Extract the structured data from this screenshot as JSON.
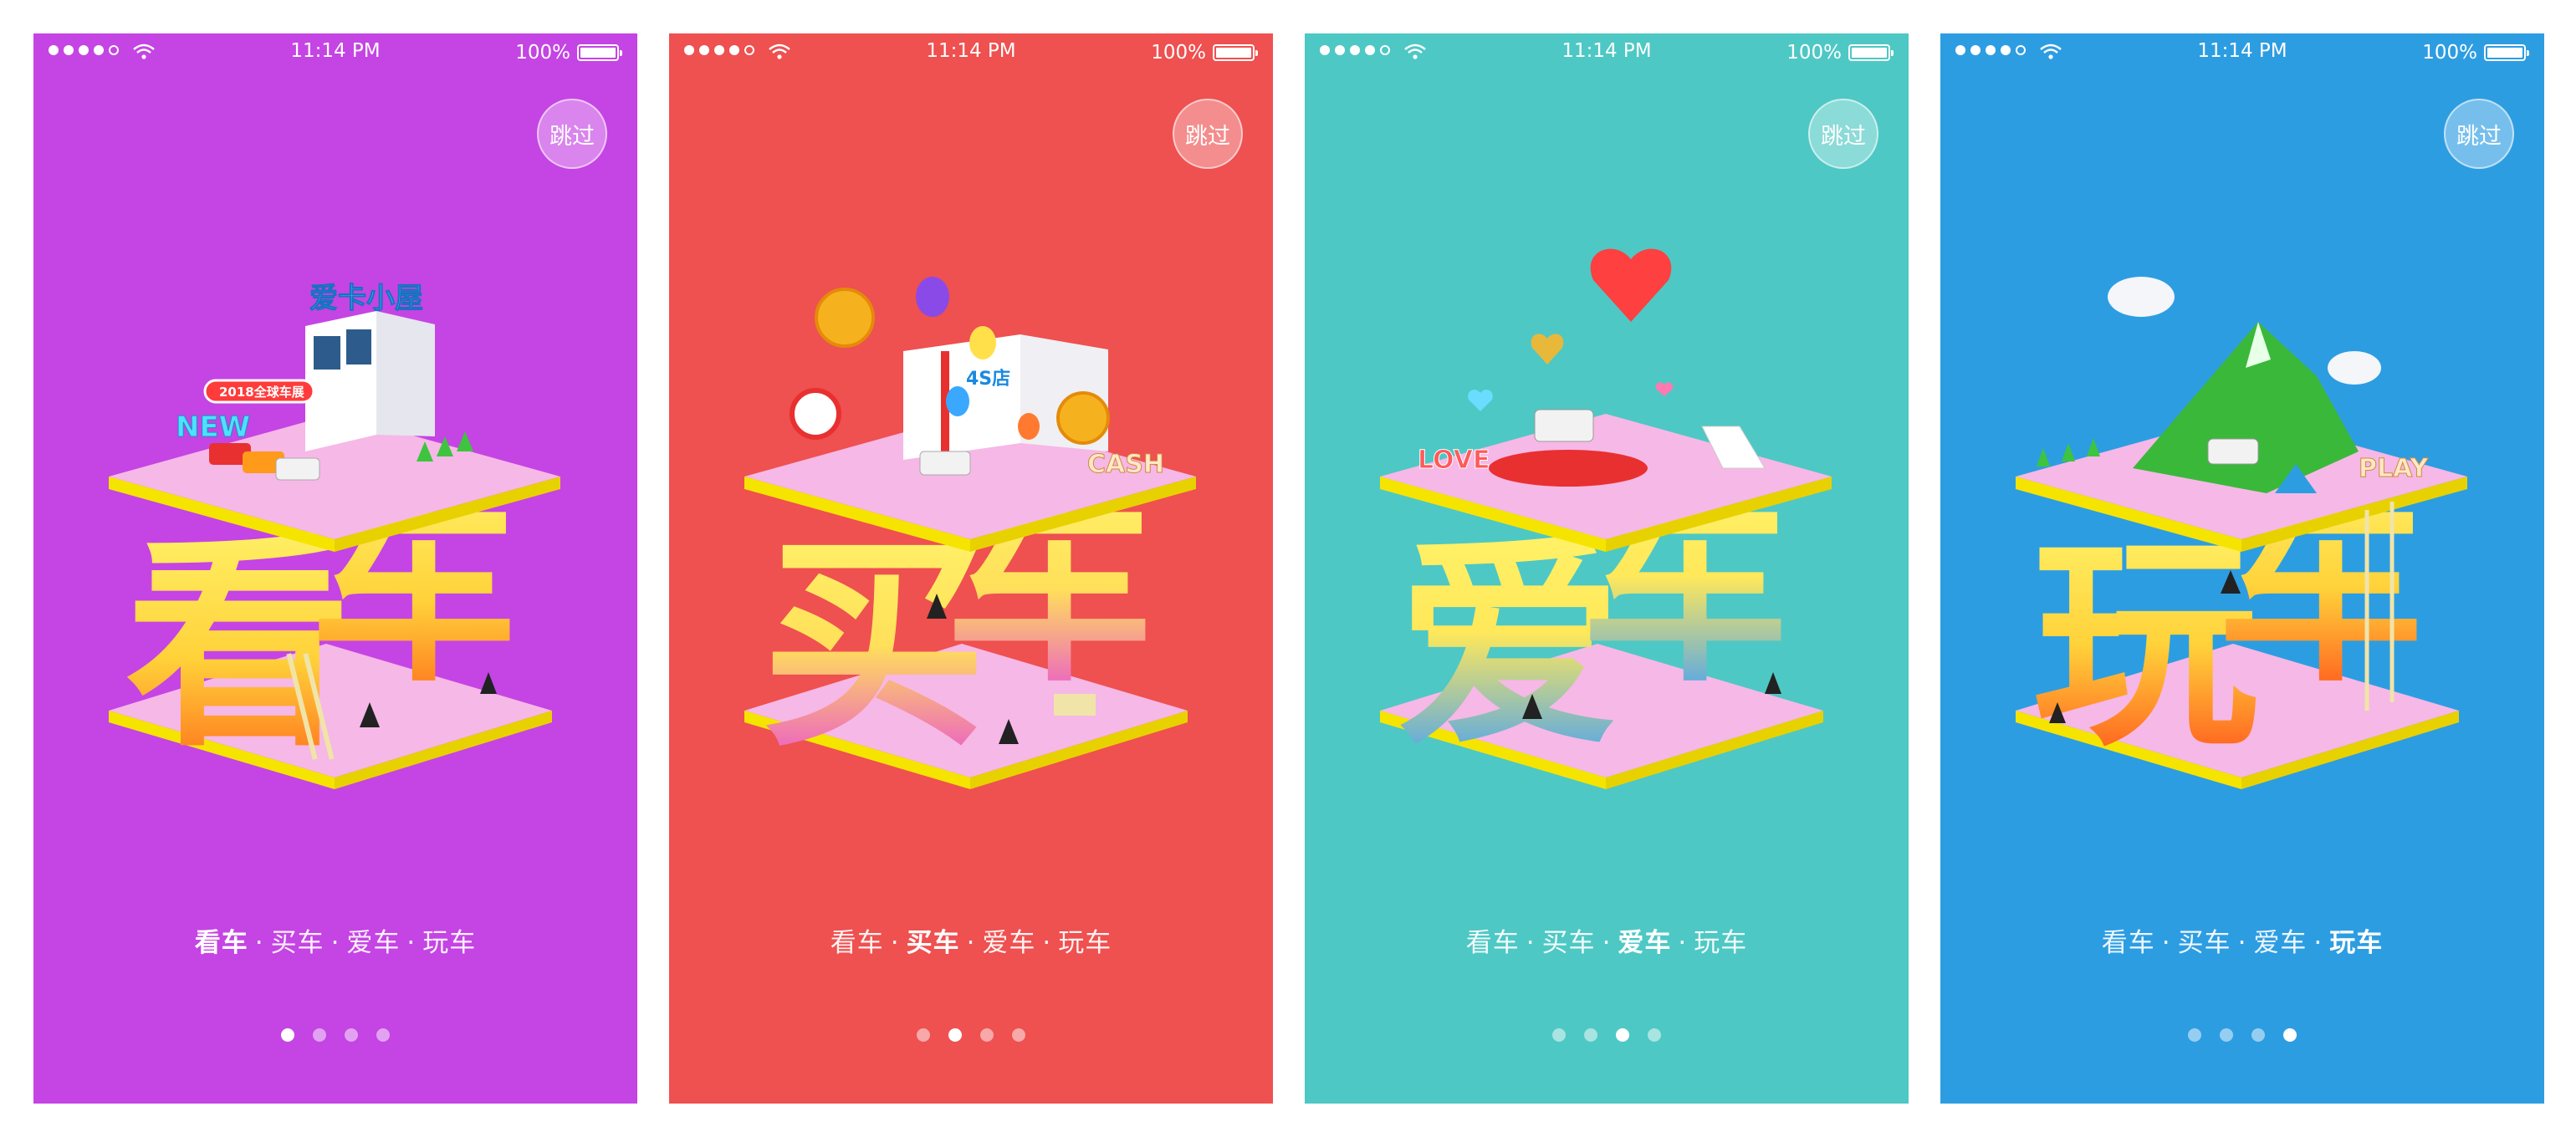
{
  "screens": [
    {
      "bg": "#c544e4",
      "status": {
        "time": "11:14 PM",
        "battery": "100%"
      },
      "skip_label": "跳过",
      "tabs": [
        "看车",
        "买车",
        "爱车",
        "玩车"
      ],
      "active_tab": 0,
      "big_chars": [
        "看",
        "车"
      ],
      "sign_text": "爱卡小屋",
      "banner_text": "2018全球车展",
      "tag_text": "NEW"
    },
    {
      "bg": "#ef5050",
      "status": {
        "time": "11:14 PM",
        "battery": "100%"
      },
      "skip_label": "跳过",
      "tabs": [
        "看车",
        "买车",
        "爱车",
        "玩车"
      ],
      "active_tab": 1,
      "big_chars": [
        "买",
        "车"
      ],
      "sign_text": "4S店",
      "tag_text": "CASH"
    },
    {
      "bg": "#4ec8c4",
      "status": {
        "time": "11:14 PM",
        "battery": "100%"
      },
      "skip_label": "跳过",
      "tabs": [
        "看车",
        "买车",
        "爱车",
        "玩车"
      ],
      "active_tab": 2,
      "big_chars": [
        "爱",
        "车"
      ],
      "tag_text": "LOVE"
    },
    {
      "bg": "#2d9de2",
      "status": {
        "time": "11:14 PM",
        "battery": "100%"
      },
      "skip_label": "跳过",
      "tabs": [
        "看车",
        "买车",
        "爱车",
        "玩车"
      ],
      "active_tab": 3,
      "big_chars": [
        "玩",
        "车"
      ],
      "tag_text": "PLAY"
    }
  ],
  "pager_count": 4
}
